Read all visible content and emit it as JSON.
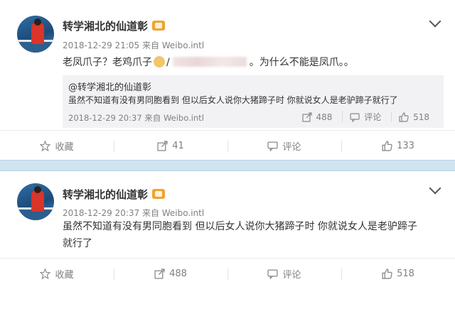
{
  "post1": {
    "username": "转学湘北的仙道彰",
    "meta": "2018-12-29 21:05 来自 Weibo.intl",
    "text_part1": "老凤爪子？老鸡爪子",
    "text_part2": "/",
    "text_part3": "。为什么不能是凤爪。。",
    "quote": {
      "username": "@转学湘北的仙道彰",
      "text": "虽然不知道有没有男同胞看到 但以后女人说你大猪蹄子时 你就说女人是老驴蹄子就行了",
      "meta": "2018-12-29 20:37 来自 Weibo.intl",
      "reposts": "488",
      "comment_label": "评论",
      "likes": "518"
    },
    "actions": {
      "favorite_label": "收藏",
      "repost_count": "41",
      "comment_label": "评论",
      "like_count": "133"
    }
  },
  "post2": {
    "username": "转学湘北的仙道彰",
    "meta": "2018-12-29 20:37 来自 Weibo.intl",
    "text_line1": "虽然不知道有没有男同胞看到 但以后女人说你大猪蹄子时 你就说女人是老驴蹄子",
    "text_line2": "就行了",
    "actions": {
      "favorite_label": "收藏",
      "repost_count": "488",
      "comment_label": "评论",
      "like_count": "518"
    }
  },
  "colors": {
    "divider": "#cfe3f0",
    "quote_bg": "#f2f2f5",
    "meta_text": "#808080"
  }
}
